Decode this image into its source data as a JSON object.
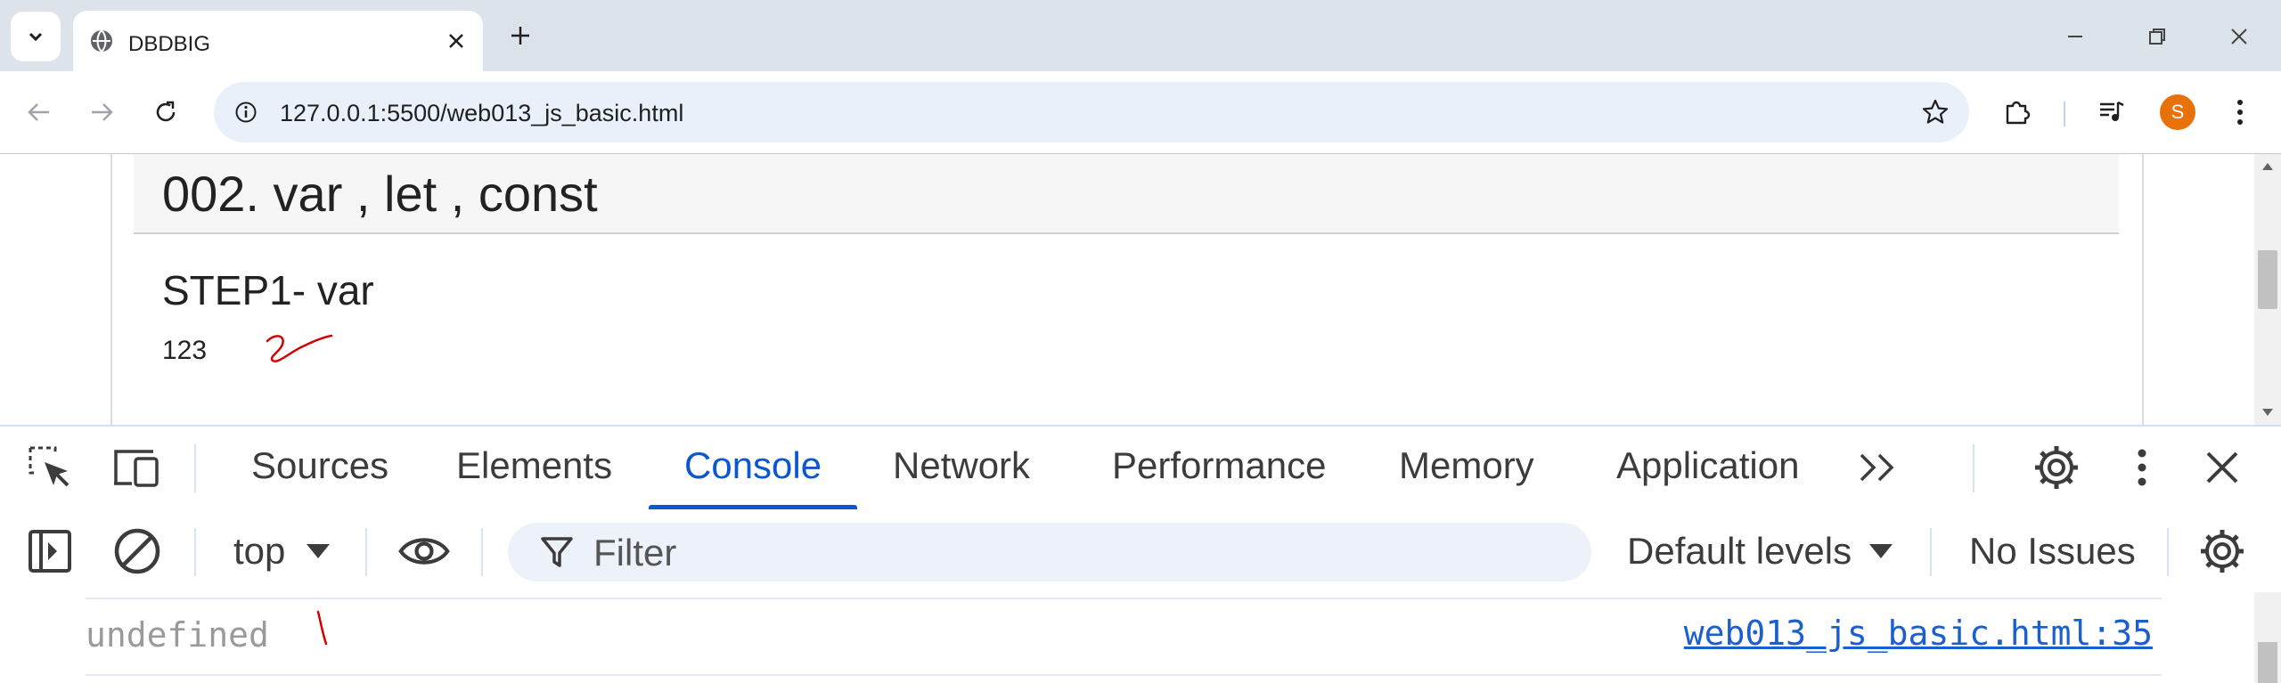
{
  "browser": {
    "tab_title": "DBDBIG",
    "url": "127.0.0.1:5500/web013_js_basic.html",
    "profile_initial": "S"
  },
  "page": {
    "section_title": "002. var , let , const",
    "step_title": "STEP1- var",
    "step_value": "123"
  },
  "devtools": {
    "tabs": [
      "Sources",
      "Elements",
      "Console",
      "Network",
      "Performance",
      "Memory",
      "Application"
    ],
    "active_tab": "Console",
    "context": "top",
    "filter_placeholder": "Filter",
    "levels": "Default levels",
    "issues": "No Issues",
    "messages": [
      {
        "text": "undefined",
        "source": "web013_js_basic.html:35"
      }
    ]
  },
  "colors": {
    "accent": "#0b57d0",
    "annotation": "#d40000",
    "avatar": "#e8710a"
  }
}
